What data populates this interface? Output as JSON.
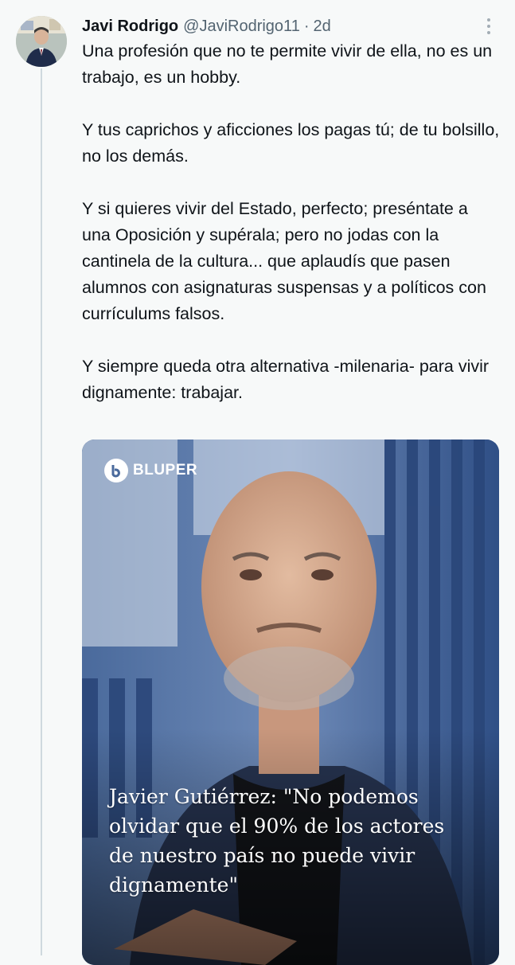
{
  "tweet": {
    "author": {
      "display_name": "Javi Rodrigo",
      "handle": "@JaviRodrigo11",
      "separator": "·",
      "time": "2d"
    },
    "more_icon": "more-options-icon",
    "paragraphs": [
      "Una profesión que no te permite vivir de ella, no es un trabajo, es un hobby.",
      "Y tus caprichos y aficciones los pagas tú; de tu bolsillo, no los demás.",
      "Y si quieres vivir del Estado, perfecto; preséntate a una Oposición y supérala; pero no jodas con la cantinela de la cultura... que aplaudís que pasen alumnos con asignaturas suspensas y a políticos con currículums falsos.",
      "Y siempre queda otra alternativa -milenaria- para vivir dignamente: trabajar."
    ],
    "media": {
      "brand": "BLUPER",
      "headline": "Javier Gutiérrez: \"No podemos olvidar que el 90% de los actores de nuestro país no puede vivir dignamente\""
    }
  },
  "colors": {
    "background": "#f7f9f9",
    "text": "#0f1419",
    "secondary_text": "#536471",
    "thread_line": "#cfd9de"
  }
}
